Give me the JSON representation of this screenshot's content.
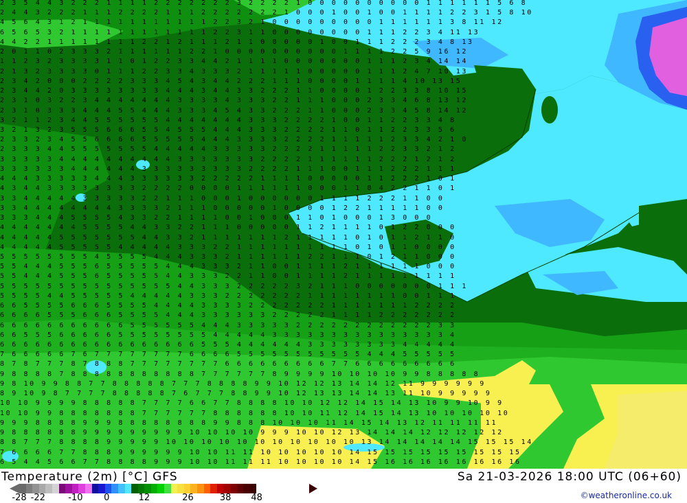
{
  "map": {
    "title": "Temperature (2m) [°C] GFS",
    "run_info": "Sa 21-03-2026 18:00 UTC (06+60)",
    "credit": "©weatheronline.co.uk",
    "legend": {
      "tick_labels": [
        "-28",
        "-22",
        "-10",
        "0",
        "12",
        "26",
        "38",
        "48"
      ],
      "tick_values": [
        -28,
        -22,
        -10,
        0,
        12,
        26,
        38,
        48
      ],
      "min": -28,
      "max": 48,
      "colors": [
        "#6a6a6a",
        "#7d7d7d",
        "#929292",
        "#a8a8a8",
        "#bebebe",
        "#d4d4d4",
        "#7a0a7a",
        "#a010a0",
        "#c020c0",
        "#e040e0",
        "#f070f0",
        "#1010a0",
        "#1818d0",
        "#2050f0",
        "#3090ff",
        "#40c0ff",
        "#50e8ff",
        "#006000",
        "#007800",
        "#009000",
        "#00b000",
        "#00d000",
        "#40e040",
        "#f0f050",
        "#f8e040",
        "#ffd030",
        "#ffb020",
        "#ff9010",
        "#ff6000",
        "#e02000",
        "#c00000",
        "#a00000",
        "#800000",
        "#600000",
        "#4a0000",
        "#3a0000"
      ]
    },
    "field_colors": {
      "dark_green": "#0a6e0a",
      "green": "#0f8f0f",
      "light_green": "#1fb01f",
      "bright_green": "#30c830",
      "cyan": "#4ee8ff",
      "light_blue": "#3fb8ff",
      "blue": "#2a60f0",
      "magenta": "#e060e0",
      "yellow": "#f8f050",
      "light_yellow": "#f4ec6a"
    },
    "grid_rows": [
      "2 3 5 4 4 3 2 2 2 1 1 1 1 2 2 2 2 2 2 2 3 2 2 2 2 1 0 0 0 0 0 0 0 0 0 0 1 1 1 1 1 1 5 6 8",
      "2 4 4 3 2 2 2 1 1 1 2 2 2 2 1 1 1 2 2 2 2 2 2 2 1 0 0 0 1 0 0 1 0 0 1 1 1 1 2 2 3 1 5 8 10",
      "4 5 6 4 3 1 2 1 1 1 1 1 1 1 1 1 1 1 2 2 3 2 1 0 0 0 0 0 0 0 0 0 1 1 1 1 1 1 3 8 11 12",
      "6 5 6 5 3 2 1 1 1 1 1 1 1 1 1 1 1 1 2 2 3 1 1 0 0 0 0 0 0 0 0 1 1 1 2 2 3 4 11 13",
      "4 4 2 2 1 1 1 1 1 1 1 1 2 2 1 2 1 1 1 2 1 1 0 0 0 0 0 1 0 0 1 1 1 2 2 2 3 4 8 13",
      "2 0 1 1 0 2 3 3 3 2 1 1 1 1 1 1 2 2 1 0 0 0 0 0 0 0 0 0 0 1 1 1 1 2 2 5 9 16 12",
      "1 1 2 3 2 3 3 3 3 1 1 0 1 2 2 3 3 4 4 2 1 1 1 1 0 0 0 0 0 0 0 1 1 1 2 3 4 14 14",
      "2 1 3 2 3 3 3 3 0 1 1 1 2 2 3 3 4 3 3 3 2 1 1 1 1 1 0 0 0 0 0 1 1 1 2 4 7 10 13",
      "2 3 4 2 0 0 0 2 2 2 2 3 3 3 4 5 4 3 4 4 2 2 2 1 1 1 0 0 0 0 1 1 1 1 4 10 13 15",
      "2 3 4 4 2 0 3 3 3 3 3 3 3 3 4 4 4 3 4 4 3 3 2 2 2 1 1 0 0 0 0 1 2 2 3 3 8 10 15",
      "2 3 1 0 3 2 2 3 4 4 4 4 4 4 4 3 3 3 3 4 3 3 3 2 2 1 1 1 0 0 0 2 3 3 4 6 8 13 12",
      "2 3 1 0 3 3 3 4 4 4 5 5 4 4 4 3 3 3 4 5 4 3 3 2 2 2 1 1 0 0 0 2 3 3 4 5 8 14 12",
      "3 2 1 1 2 3 4 4 5 5 5 5 5 5 4 4 4 4 4 4 4 3 3 3 2 2 2 2 1 0 0 1 1 2 2 3 3 4 8",
      "3 2 1 3 2 3 5 5 5 6 6 6 5 5 4 5 5 5 4 4 4 3 3 3 2 2 2 2 1 1 0 1 1 2 2 3 3 5 6",
      "2 3 3 2 3 4 5 5 6 6 6 6 5 5 5 5 5 4 4 4 3 3 3 3 2 2 2 2 1 1 1 1 1 2 3 3 4 2 1 0",
      "2 3 3 3 4 4 5 5 5 5 5 5 5 4 4 4 4 4 3 3 3 3 3 2 2 2 2 1 1 1 1 1 2 2 3 3 2 1 2",
      "3 3 3 3 3 4 4 4 4 4 4 4 4 4 4 3 3 3 3 3 3 3 2 2 2 2 1 1 1 1 1 1 2 2 2 1 2 1 2",
      "3 3 3 3 3 3 4 4 4 4 4 4 3 3 3 3 3 3 3 3 3 2 2 2 2 1 1 1 0 0 1 1 1 2 2 2 1 1 1",
      "4 4 4 3 3 3 3 3 4 4 4 3 3 3 3 3 3 2 2 2 2 2 1 1 1 1 0 0 0 0 0 1 1 2 2 2 1 0 1",
      "4 3 4 4 3 3 3 3 3 3 3 3 2 2 2 2 0 0 0 0 1 1 1 1 1 1 0 0 0 1 1 0 4 2 2 1 1 0 1",
      "3 3 4 4 4 4 4 3 3 3 3 3 2 2 1 1 1 0 0 0 1 0 0 0 0 0 0 1 1 1 1 2 2 2 1 1 0 0",
      "3 3 4 4 4 4 4 4 4 4 3 3 3 3 2 1 1 1 0 0 0 0 0 1 0 0 0 0 1 2 2 1 1 1 1 1 0 0",
      "3 3 3 4 4 4 5 5 5 5 4 3 3 2 2 1 1 1 1 0 0 1 0 0 0 1 1 0 1 0 0 0 1 3 0 0 0",
      "4 4 4 4 4 4 4 5 5 5 5 4 4 3 3 2 2 1 1 1 0 0 0 0 0 1 1 2 1 1 1 1 0 1 2 2 0 0 0",
      "4 4 4 4 4 5 5 5 5 5 5 5 4 4 3 3 2 1 1 1 1 1 1 1 2 1 1 1 1 1 0 1 0 1 1 2 1 1 0",
      "4 4 4 4 4 5 5 5 5 5 4 4 4 4 4 3 3 3 2 2 1 1 1 1 1 1 1 1 1 1 0 1 0 1 1 0 0 0 0",
      "5 5 5 5 5 5 5 5 4 5 5 5 5 4 4 4 3 3 3 2 1 1 1 1 1 1 2 2 1 1 1 0 1 2 1 1 0 0 0",
      "5 5 4 4 4 5 5 5 6 5 5 5 5 5 4 4 4 3 3 3 2 1 1 0 0 1 1 1 1 2 1 1 1 1 1 1 0 0 0",
      "5 5 4 4 4 5 5 5 6 5 5 5 5 5 4 4 3 3 3 2 2 1 1 0 0 1 1 1 1 2 1 1 1 1 1 1 1 1 1",
      "5 5 5 5 5 5 5 5 5 5 5 5 5 5 5 4 4 3 3 3 2 2 2 2 2 3 2 1 1 1 0 0 0 0 0 0 0 1 1 1",
      "5 5 5 5 4 4 5 5 5 5 5 4 4 4 4 4 3 3 3 2 2 2 2 2 2 2 1 1 1 1 1 1 1 1 0 0 1 1 1",
      "6 6 5 5 5 5 6 6 6 5 5 5 5 4 4 4 4 3 3 3 3 2 2 2 2 2 2 2 1 1 1 1 1 1 1 2 2 2 2",
      "6 6 6 6 5 5 5 6 6 6 5 5 5 5 4 4 4 3 3 3 3 3 3 2 2 2 2 2 1 1 1 1 2 2 2 2 2 2 2",
      "6 6 6 6 6 6 6 6 6 6 6 5 5 5 5 5 5 4 4 4 3 3 3 3 3 2 2 2 2 2 2 2 2 2 2 2 2 3 3",
      "6 6 5 5 5 6 6 6 6 6 5 5 5 5 5 5 5 5 4 4 4 4 4 3 3 3 3 3 3 3 3 3 3 3 3 3 3 3 4",
      "6 6 6 6 6 6 6 6 6 6 6 6 6 6 6 6 6 5 5 5 4 4 4 4 4 4 3 3 3 3 3 3 3 3 4 4 4 4 4",
      "7 6 6 6 6 6 7 6 7 7 7 7 7 7 7 7 6 6 6 6 5 5 5 5 5 5 5 5 5 5 5 4 4 4 5 5 5 5 5",
      "8 7 8 7 7 7 8 7 8 8 8 7 7 7 7 7 7 7 7 6 6 6 6 6 6 6 6 6 7 7 6 6 6 6 6 6 6 6 6",
      "9 8 8 8 8 7 8 8 8 8 8 8 8 8 8 8 8 7 7 7 7 7 7 8 9 9 9 9 10 10 10 10 9 9 8 8 8 8 8",
      "9 8 10 9 9 8 8 7 7 8 8 8 8 8 7 7 7 8 8 8 8 9 9 10 12 12 13 14 14 12 11 9 9 9 9 9 9",
      "8 9 10 9 8 7 7 7 7 8 8 8 8 8 7 6 7 7 7 8 8 9 9 10 12 13 13 14 14 13 11 10 9 9 9 9 9",
      "10 10 9 9 9 9 8 8 8 8 8 7 7 7 7 6 6 7 7 8 8 8 8 10 10 12 12 14 15 14 13 10 9 9 10 9 9",
      "10 10 9 9 8 8 8 8 8 8 8 7 7 7 7 7 7 8 8 8 8 8 8 10 10 11 12 14 15 14 13 10 10 10 10 10",
      "9 9 9 8 8 8 8 9 9 9 8 8 8 8 8 8 8 8 9 9 8 8 8 10 10 10 11 14 15 14 13 12 11 11 11 11",
      "9 8 8 8 8 8 8 9 9 9 9 9 9 9 9 9 10 10 10 10 9 9 9 10 10 12 13 14 14 14 12 12 12 12 12",
      "8 8 7 7 7 8 8 8 8 9 9 9 9 9 10 10 10 10 10 10 10 10 10 10 10 13 14 14 14 14 14 15 15 15 14",
      "7 6 6 6 6 7 7 8 8 8 9 9 9 9 9 9 10 10 11 11 10 10 10 10 10 14 15 15 15 15 15 15 15 15 15",
      "6 5 4 4 5 6 6 7 7 8 8 8 8 9 9 9 10 10 11 11 11 10 10 10 10 14 15 16 16 16 16 16 16 16 16"
    ]
  }
}
